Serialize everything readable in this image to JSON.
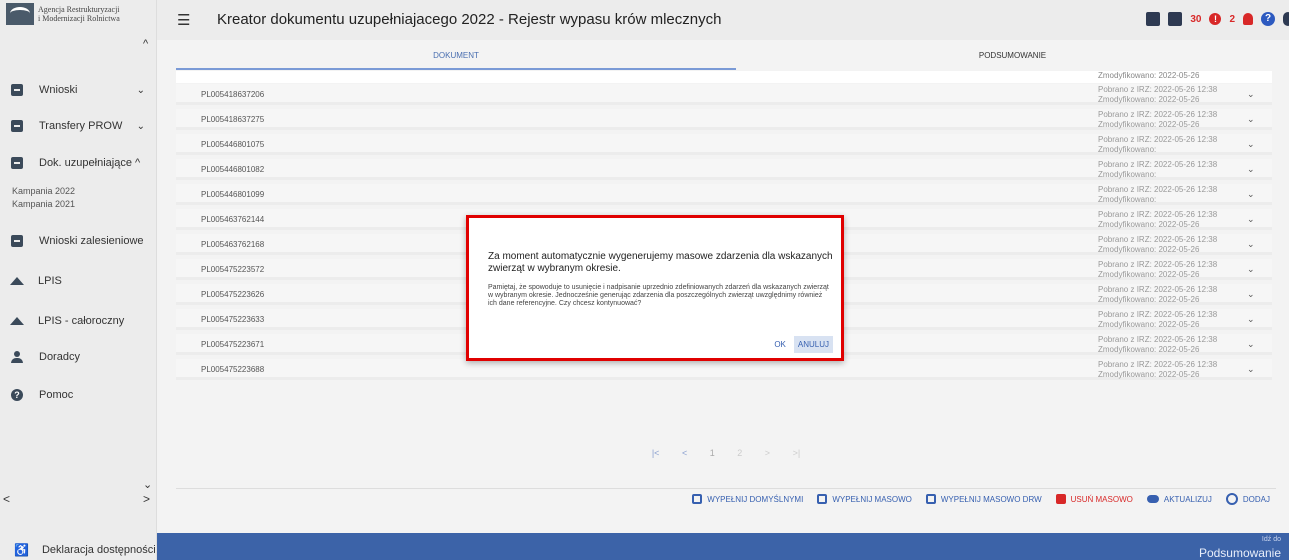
{
  "sidebar": {
    "logo_line1": "Agencja Restrukturyzacji",
    "logo_line2": "i Modernizacji Rolnictwa",
    "items": [
      {
        "label": "Wnioski"
      },
      {
        "label": "Transfery PROW"
      },
      {
        "label": "Dok. uzupełniające"
      },
      {
        "label": "Wnioski zalesieniowe"
      },
      {
        "label": "LPIS"
      },
      {
        "label": "LPIS - całoroczny"
      },
      {
        "label": "Doradcy"
      },
      {
        "label": "Pomoc"
      }
    ],
    "sub_items": [
      "Kampania 2022",
      "Kampania 2021"
    ],
    "accessibility": "Deklaracja dostępności"
  },
  "header": {
    "title": "Kreator dokumentu uzupełniajacego 2022 - Rejestr wypasu krów mlecznych",
    "count_a": "30",
    "count_b": "2"
  },
  "tabs": [
    {
      "label": "DOKUMENT"
    },
    {
      "label": "PODSUMOWANIE"
    }
  ],
  "top_partial_meta": "Zmodyfikowano: 2022-05-26",
  "rows": [
    {
      "id": "PL005418637206",
      "line1": "Pobrano z IRZ: 2022-05-26 12:38",
      "line2": "Zmodyfikowano: 2022-05-26"
    },
    {
      "id": "PL005418637275",
      "line1": "Pobrano z IRZ: 2022-05-26 12:38",
      "line2": "Zmodyfikowano: 2022-05-26"
    },
    {
      "id": "PL005446801075",
      "line1": "Pobrano z IRZ: 2022-05-26 12:38",
      "line2": "Zmodyfikowano:"
    },
    {
      "id": "PL005446801082",
      "line1": "Pobrano z IRZ: 2022-05-26 12:38",
      "line2": "Zmodyfikowano:"
    },
    {
      "id": "PL005446801099",
      "line1": "Pobrano z IRZ: 2022-05-26 12:38",
      "line2": "Zmodyfikowano:"
    },
    {
      "id": "PL005463762144",
      "line1": "Pobrano z IRZ: 2022-05-26 12:38",
      "line2": "Zmodyfikowano: 2022-05-26"
    },
    {
      "id": "PL005463762168",
      "line1": "Pobrano z IRZ: 2022-05-26 12:38",
      "line2": "Zmodyfikowano: 2022-05-26"
    },
    {
      "id": "PL005475223572",
      "line1": "Pobrano z IRZ: 2022-05-26 12:38",
      "line2": "Zmodyfikowano: 2022-05-26"
    },
    {
      "id": "PL005475223626",
      "line1": "Pobrano z IRZ: 2022-05-26 12:38",
      "line2": "Zmodyfikowano: 2022-05-26"
    },
    {
      "id": "PL005475223633",
      "line1": "Pobrano z IRZ: 2022-05-26 12:38",
      "line2": "Zmodyfikowano: 2022-05-26"
    },
    {
      "id": "PL005475223671",
      "line1": "Pobrano z IRZ: 2022-05-26 12:38",
      "line2": "Zmodyfikowano: 2022-05-26"
    },
    {
      "id": "PL005475223688",
      "line1": "Pobrano z IRZ: 2022-05-26 12:38",
      "line2": "Zmodyfikowano: 2022-05-26"
    }
  ],
  "pager": {
    "first": "|<",
    "prev": "<",
    "current": "1",
    "next_page": "2",
    "next": ">",
    "last": ">|"
  },
  "actions": {
    "fill_default": "WYPEŁNIJ DOMYŚLNYMI",
    "fill_mass": "WYPEŁNIJ MASOWO",
    "fill_mass_drw": "WYPEŁNIJ MASOWO DRW",
    "delete_mass": "USUŃ MASOWO",
    "update": "AKTUALIZUJ",
    "add": "DODAJ"
  },
  "footer": {
    "small": "Idź do",
    "big": "Podsumowanie"
  },
  "modal": {
    "main": "Za moment automatycznie wygenerujemy masowe zdarzenia dla wskazanych zwierząt w wybranym okresie.",
    "sub": "Pamiętaj, że spowoduje to usunięcie i nadpisanie uprzednio zdefiniowanych zdarzeń dla wskazanych zwierząt w wybranym okresie. Jednocześnie generując zdarzenia dla poszczególnych zwierząt uwzględnimy również ich dane referencyjne. Czy chcesz kontynuować?",
    "ok": "OK",
    "cancel": "ANULUJ"
  }
}
